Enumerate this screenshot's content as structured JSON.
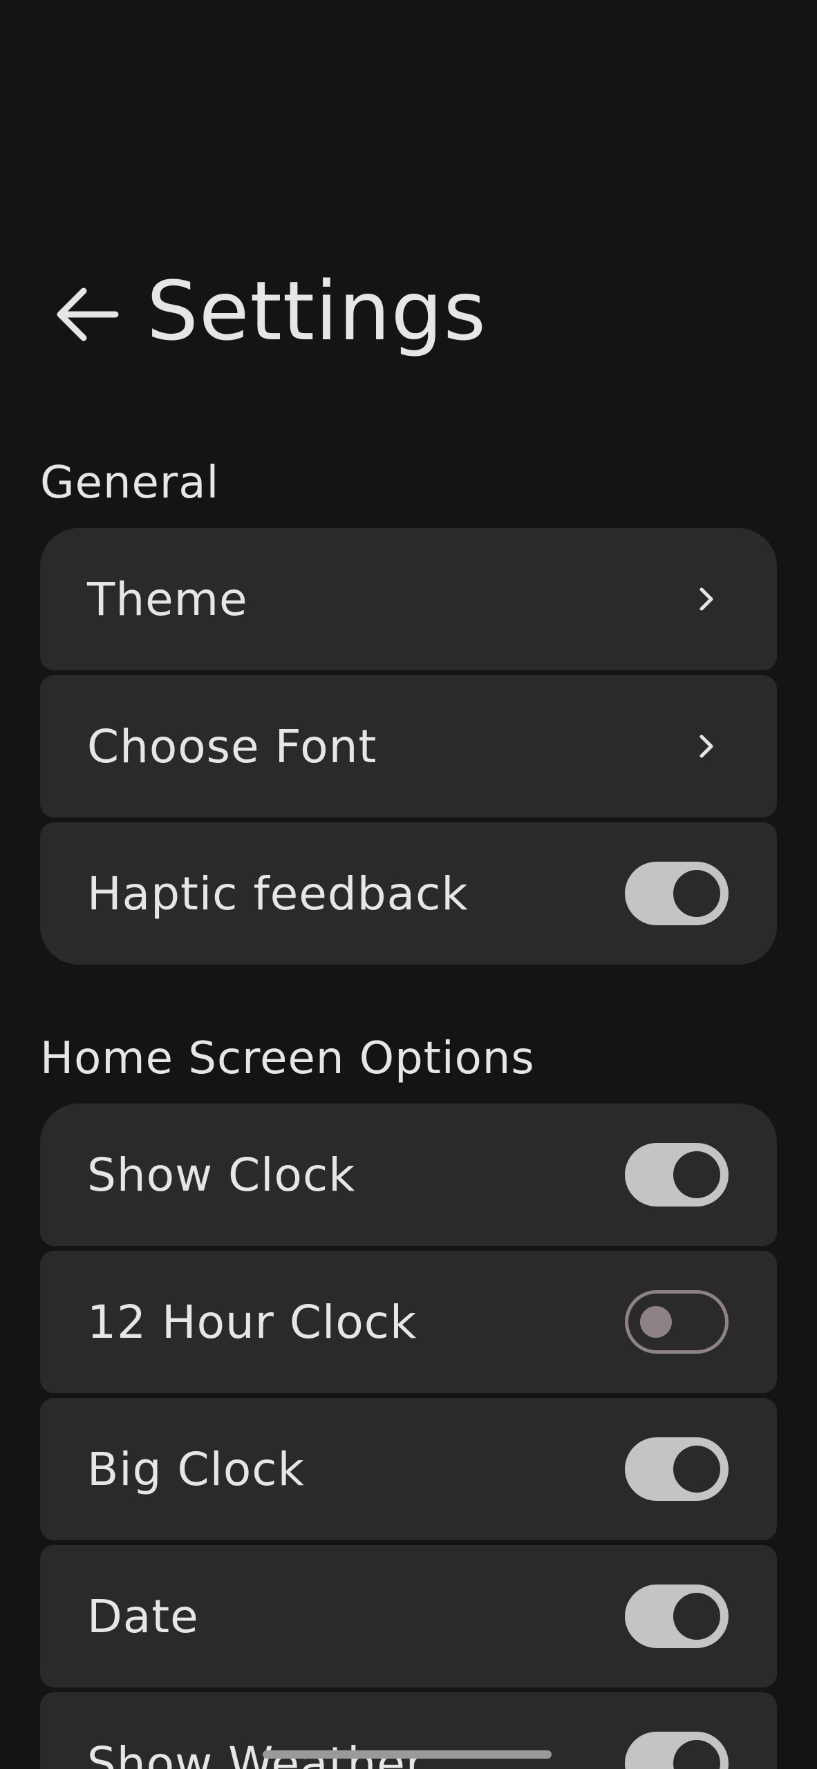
{
  "header": {
    "title": "Settings",
    "back_icon": "arrow-left-icon"
  },
  "sections": [
    {
      "header": "General",
      "items": [
        {
          "label": "Theme",
          "control": "chevron"
        },
        {
          "label": "Choose Font",
          "control": "chevron"
        },
        {
          "label": "Haptic feedback",
          "control": "toggle",
          "on": true
        }
      ]
    },
    {
      "header": "Home Screen Options",
      "items": [
        {
          "label": "Show Clock",
          "control": "toggle",
          "on": true
        },
        {
          "label": "12 Hour Clock",
          "control": "toggle",
          "on": false
        },
        {
          "label": "Big Clock",
          "control": "toggle",
          "on": true
        },
        {
          "label": "Date",
          "control": "toggle",
          "on": true
        },
        {
          "label": "Show Weather",
          "control": "toggle",
          "on": true
        }
      ]
    }
  ],
  "colors": {
    "background": "#141414",
    "row_background": "#2a2a2a",
    "text": "#e6e6e6",
    "toggle_on_track": "#c4c4c4",
    "toggle_off_outline": "#8d8386"
  }
}
